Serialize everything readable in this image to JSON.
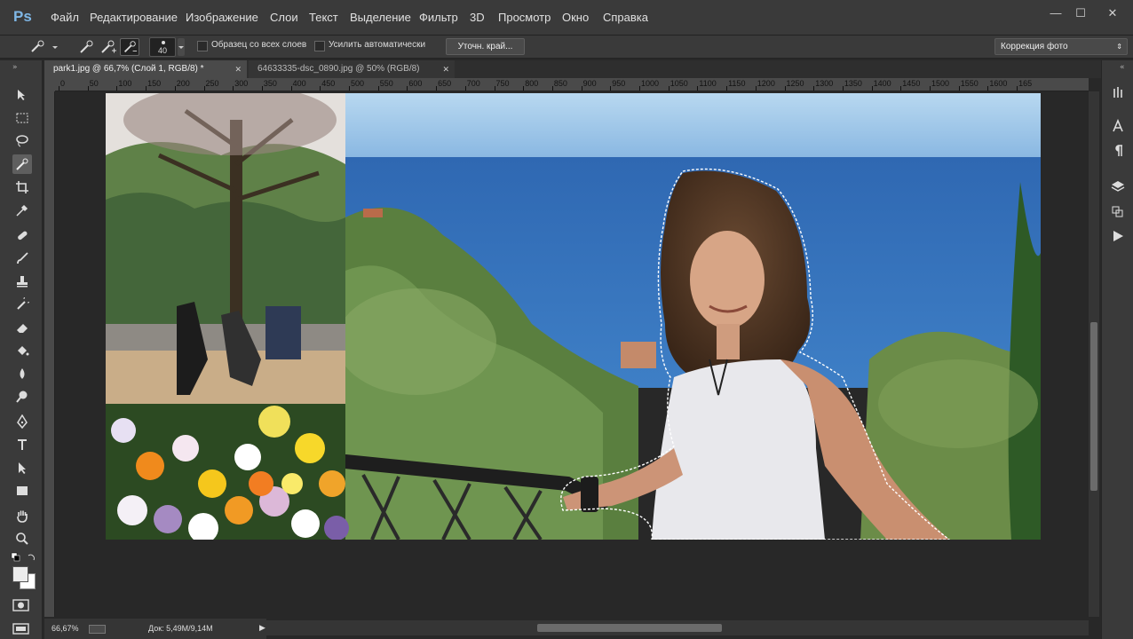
{
  "app": {
    "logo": "Ps"
  },
  "menu": {
    "file": "Файл",
    "edit": "Редактирование",
    "image": "Изображение",
    "layers": "Слои",
    "text": "Текст",
    "select": "Выделение",
    "filter": "Фильтр",
    "three_d": "3D",
    "view": "Просмотр",
    "window": "Окно",
    "help": "Справка"
  },
  "window_controls": {
    "minimize": "—",
    "maximize": "☐",
    "close": "✕"
  },
  "options_bar": {
    "brush_size": "40",
    "sample_all_layers": "Образец со всех слоев",
    "auto_enhance": "Усилить автоматически",
    "refine_edge": "Уточн. край...",
    "workspace": "Коррекция фото"
  },
  "tabs": [
    {
      "label": "park1.jpg @ 66,7% (Слой 1, RGB/8) *",
      "close": "✕"
    },
    {
      "label": "64633335-dsc_0890.jpg @ 50% (RGB/8)",
      "close": "✕"
    }
  ],
  "ruler_h_ticks": [
    "0",
    "50",
    "100",
    "150",
    "200",
    "250",
    "300",
    "350",
    "400",
    "450",
    "500",
    "550",
    "600",
    "650",
    "700",
    "750",
    "800",
    "850",
    "900",
    "950",
    "1000",
    "1050",
    "1100",
    "1150",
    "1200",
    "1250",
    "1300",
    "1350",
    "1400",
    "1450",
    "1500",
    "1550",
    "1600",
    "165"
  ],
  "status": {
    "zoom": "66,67%",
    "doc": "Док: 5,49M/9,14M",
    "arrow": "▶"
  },
  "tools": [
    "move-tool-icon",
    "marquee-tool-icon",
    "lasso-tool-icon",
    "quick-selection-tool-icon",
    "crop-tool-icon",
    "eyedropper-tool-icon",
    "healing-brush-tool-icon",
    "brush-tool-icon",
    "clone-stamp-tool-icon",
    "history-brush-tool-icon",
    "eraser-tool-icon",
    "paint-bucket-tool-icon",
    "blur-tool-icon",
    "dodge-tool-icon",
    "pen-tool-icon",
    "type-tool-icon",
    "path-selection-tool-icon",
    "rectangle-tool-icon",
    "hand-tool-icon",
    "zoom-tool-icon"
  ],
  "colors": {
    "foreground": "#ececec",
    "background": "#ffffff",
    "ui_dark": "#282828",
    "ui_mid": "#3a3a3a",
    "accent_logo": "#7fb7e6"
  }
}
